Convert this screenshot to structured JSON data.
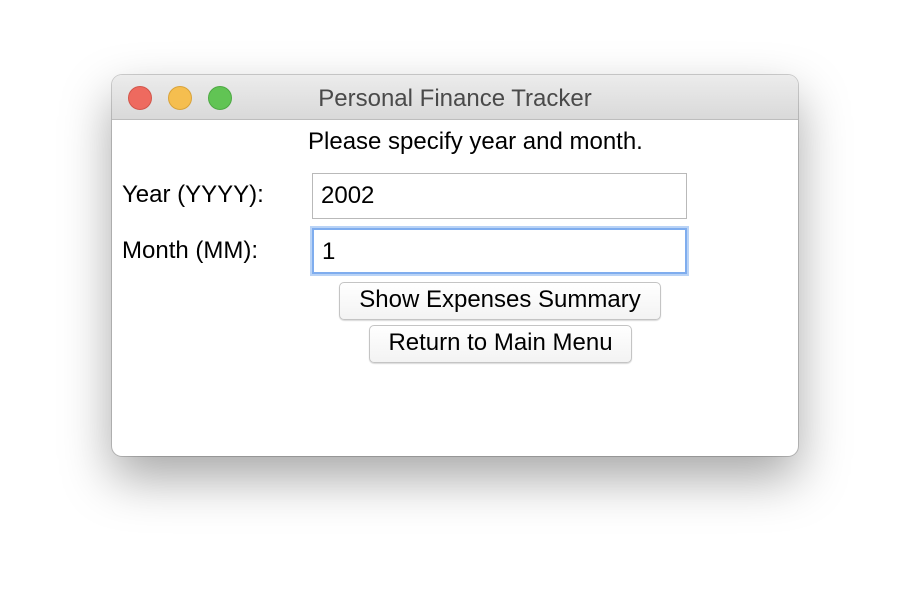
{
  "window": {
    "title": "Personal Finance Tracker",
    "controls": {
      "close_color": "#ee6a5f",
      "minimize_color": "#f5be4f",
      "maximize_color": "#61c454"
    }
  },
  "form": {
    "prompt": "Please specify year and month.",
    "year_label": "Year (YYYY):",
    "year_value": "2002",
    "month_label": "Month (MM):",
    "month_value": "1",
    "focus_color": "#7fadee"
  },
  "buttons": {
    "show_summary": "Show Expenses Summary",
    "return_menu": "Return to Main Menu"
  }
}
